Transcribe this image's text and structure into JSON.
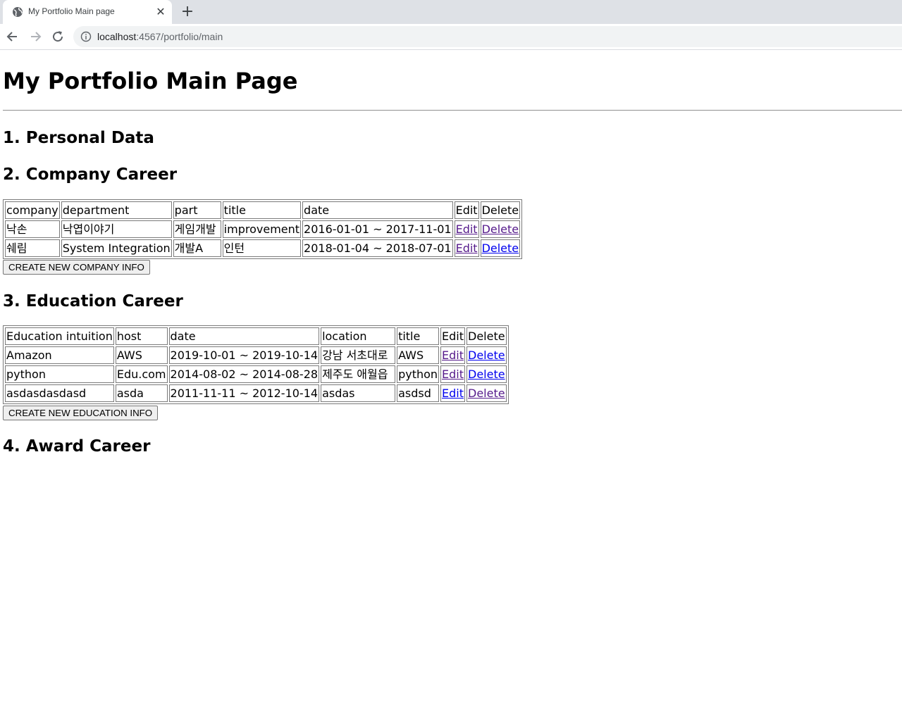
{
  "browser": {
    "tab_title": "My Portfolio Main page",
    "url_host": "localhost",
    "url_rest": ":4567/portfolio/main"
  },
  "page": {
    "title": "My Portfolio Main Page",
    "sections": {
      "personal": "1. Personal Data",
      "company": "2. Company Career",
      "education": "3. Education Career",
      "award": "4. Award Career"
    }
  },
  "company_table": {
    "headers": [
      "company",
      "department",
      "part",
      "title",
      "date",
      "Edit",
      "Delete"
    ],
    "rows": [
      {
        "company": "낙손",
        "department": "낙엽이야기",
        "part": "게임개발",
        "title": "improvement",
        "date": "2016-01-01 ~ 2017-11-01",
        "edit": "Edit",
        "delete": "Delete"
      },
      {
        "company": "쉐림",
        "department": "System Integration",
        "part": "개발A",
        "title": "인턴",
        "date": "2018-01-04 ~ 2018-07-01",
        "edit": "Edit",
        "delete": "Delete"
      }
    ],
    "create_button": "CREATE NEW COMPANY INFO"
  },
  "education_table": {
    "headers": [
      "Education intuition",
      "host",
      "date",
      "location",
      "title",
      "Edit",
      "Delete"
    ],
    "rows": [
      {
        "institution": "Amazon",
        "host": "AWS",
        "date": "2019-10-01 ~ 2019-10-14",
        "location": "강남 서초대로",
        "title": "AWS",
        "edit": "Edit",
        "delete": "Delete"
      },
      {
        "institution": "python",
        "host": "Edu.com",
        "date": "2014-08-02 ~ 2014-08-28",
        "location": "제주도 애월읍",
        "title": "python",
        "edit": "Edit",
        "delete": "Delete"
      },
      {
        "institution": "asdasdasdasd",
        "host": "asda",
        "date": "2011-11-11 ~ 2012-10-14",
        "location": "asdas",
        "title": "asdsd",
        "edit": "Edit",
        "delete": "Delete"
      }
    ],
    "create_button": "CREATE NEW EDUCATION INFO"
  },
  "colors": {
    "link": "#0000ee",
    "visited_link": "#551a8b",
    "tabbar_bg": "#dee1e6"
  },
  "icons": [
    "globe-icon",
    "close-icon",
    "plus-icon",
    "back-arrow-icon",
    "forward-arrow-icon",
    "reload-icon",
    "info-icon"
  ]
}
